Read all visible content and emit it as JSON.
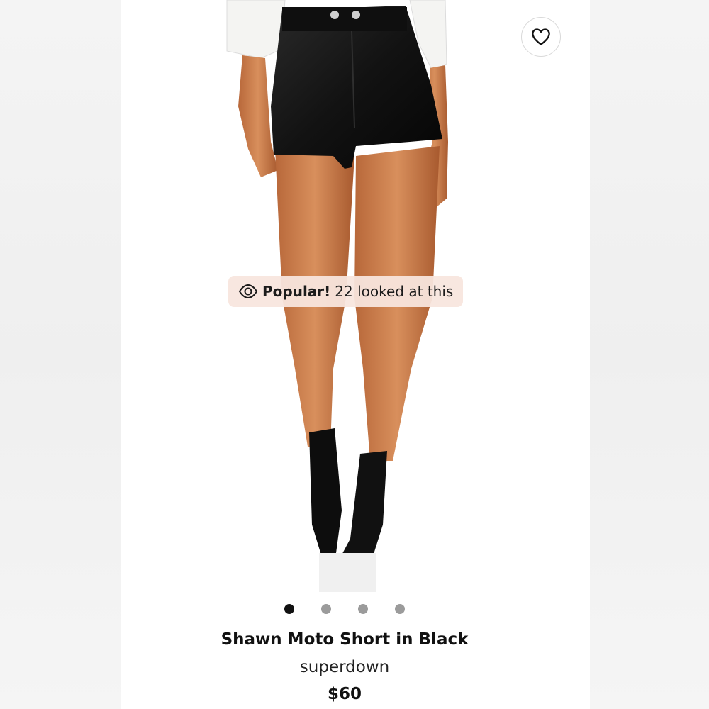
{
  "badge": {
    "strong": "Popular!",
    "text": "22 looked at this",
    "icon": "eye-icon"
  },
  "favorite": {
    "icon": "heart-icon"
  },
  "carousel": {
    "count": 4,
    "active_index": 0
  },
  "product": {
    "title": "Shawn Moto Short in Black",
    "brand": "superdown",
    "price": "$60"
  },
  "colors": {
    "badge_bg": "#f8e5de",
    "dot_active": "#111111",
    "dot_inactive": "#9b9b9b"
  }
}
